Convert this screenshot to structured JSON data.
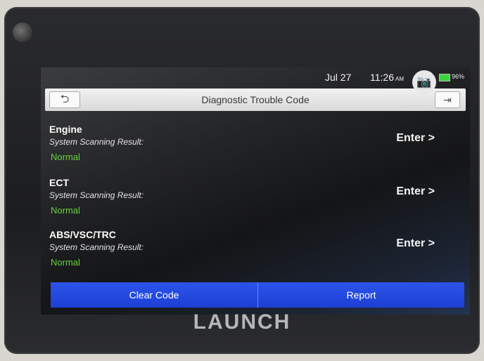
{
  "status_bar": {
    "date": "Jul 27",
    "time": "11:26",
    "ampm": "AM",
    "battery": "96%"
  },
  "header": {
    "title": "Diagnostic Trouble Code"
  },
  "systems": [
    {
      "name": "Engine",
      "label": "System Scanning Result:",
      "status": "Normal",
      "action": "Enter >"
    },
    {
      "name": "ECT",
      "label": "System Scanning Result:",
      "status": "Normal",
      "action": "Enter >"
    },
    {
      "name": "ABS/VSC/TRC",
      "label": "System Scanning Result:",
      "status": "Normal",
      "action": "Enter >"
    }
  ],
  "footer": {
    "clear_label": "Clear Code",
    "report_label": "Report"
  },
  "device": {
    "brand": "LAUNCH"
  },
  "colors": {
    "accent_blue": "#1d3fd3",
    "status_green": "#66d43b"
  }
}
